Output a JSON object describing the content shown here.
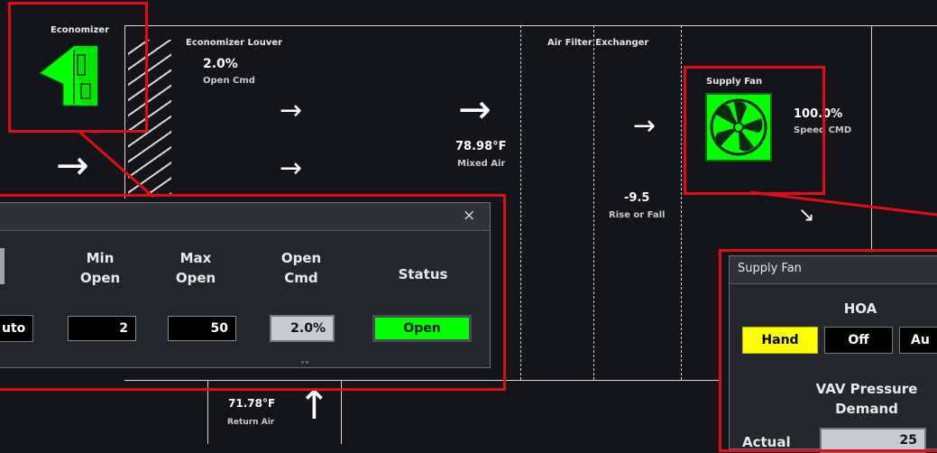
{
  "economizer": {
    "title": "Economizer"
  },
  "louver": {
    "title": "Economizer Louver",
    "value": "2.0%",
    "sub": "Open Cmd"
  },
  "mixed_air": {
    "value": "78.98°F",
    "label": "Mixed Air"
  },
  "filter": {
    "title": "Air Filter Exchanger",
    "value": "-9.5",
    "label": "Rise or Fall"
  },
  "supply_fan": {
    "title": "Supply Fan",
    "value": "100.0%",
    "label": "Speed CMD"
  },
  "return_air": {
    "value": "71.78°F",
    "label": "Return Air"
  },
  "arrows": {
    "right": "→",
    "down_right": "↘",
    "up": "↑"
  },
  "damper_popup": {
    "close": "×",
    "auto_label": "uto",
    "min_header": "Min\nOpen",
    "max_header": "Max\nOpen",
    "cmd_header": "Open\nCmd",
    "status_header": "Status",
    "min_value": "2",
    "max_value": "50",
    "cmd_value": "2.0%",
    "status_value": "Open",
    "status_color": "#00ff00"
  },
  "fan_popup": {
    "title": "Supply Fan",
    "hoa_header": "HOA",
    "hand": "Hand",
    "off": "Off",
    "auto": "Au",
    "vav_header": "VAV Pressure\nDemand",
    "actual_label": "Actual",
    "actual_value": "25",
    "hand_color": "#ffff00"
  },
  "colors": {
    "accent_green": "#00ff00",
    "highlight_red": "#e10d12",
    "background": "#13151a"
  }
}
